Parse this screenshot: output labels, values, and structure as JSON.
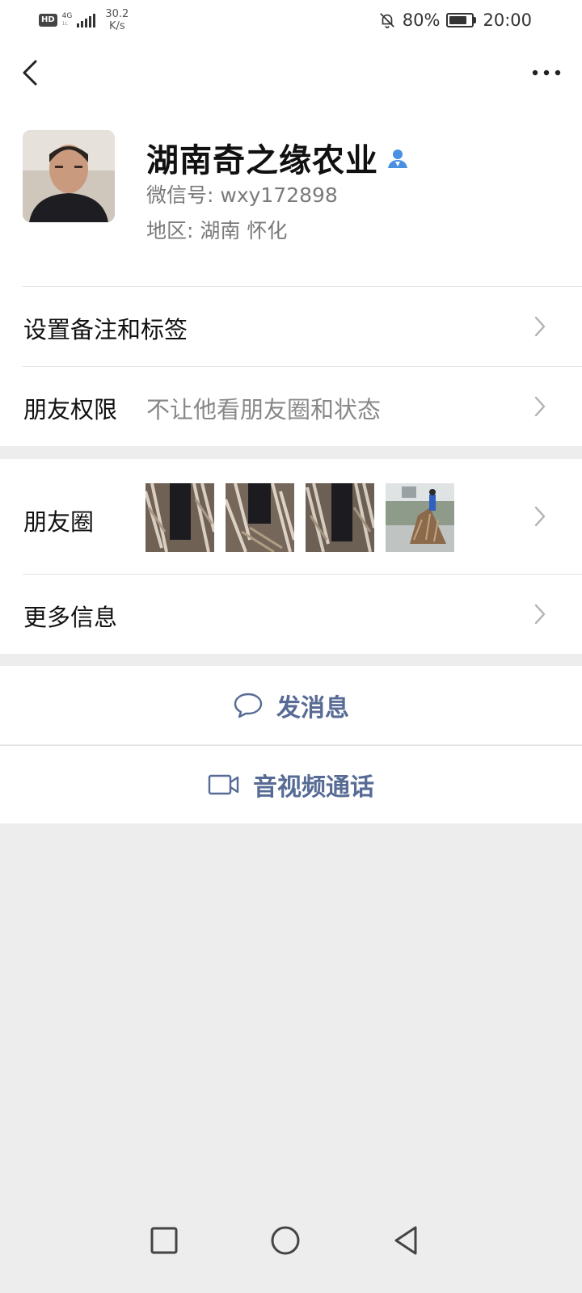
{
  "status_bar": {
    "hd": "HD",
    "net_top": "4G",
    "net_bottom": "1L",
    "speed_value": "30.2",
    "speed_unit": "K/s",
    "battery_percent": "80%",
    "battery_level": 0.8,
    "time": "20:00",
    "icons": [
      "hd-icon",
      "signal-icon",
      "bell-off-icon",
      "battery-icon"
    ]
  },
  "nav": {
    "back_icon": "chevron-left-icon",
    "more_icon": "more-dots-icon"
  },
  "profile": {
    "name": "湖南奇之缘农业",
    "verified_icon": "person-verified-icon",
    "wechat_id": "微信号: wxy172898",
    "region": "地区: 湖南  怀化"
  },
  "rows": {
    "remark_label": "设置备注和标签",
    "permission_label": "朋友权限",
    "permission_value": "不让他看朋友圈和状态",
    "moments_label": "朋友圈",
    "more_info_label": "更多信息"
  },
  "actions": {
    "message_label": "发消息",
    "call_label": "音视频通话",
    "accent_color": "#576b95"
  }
}
